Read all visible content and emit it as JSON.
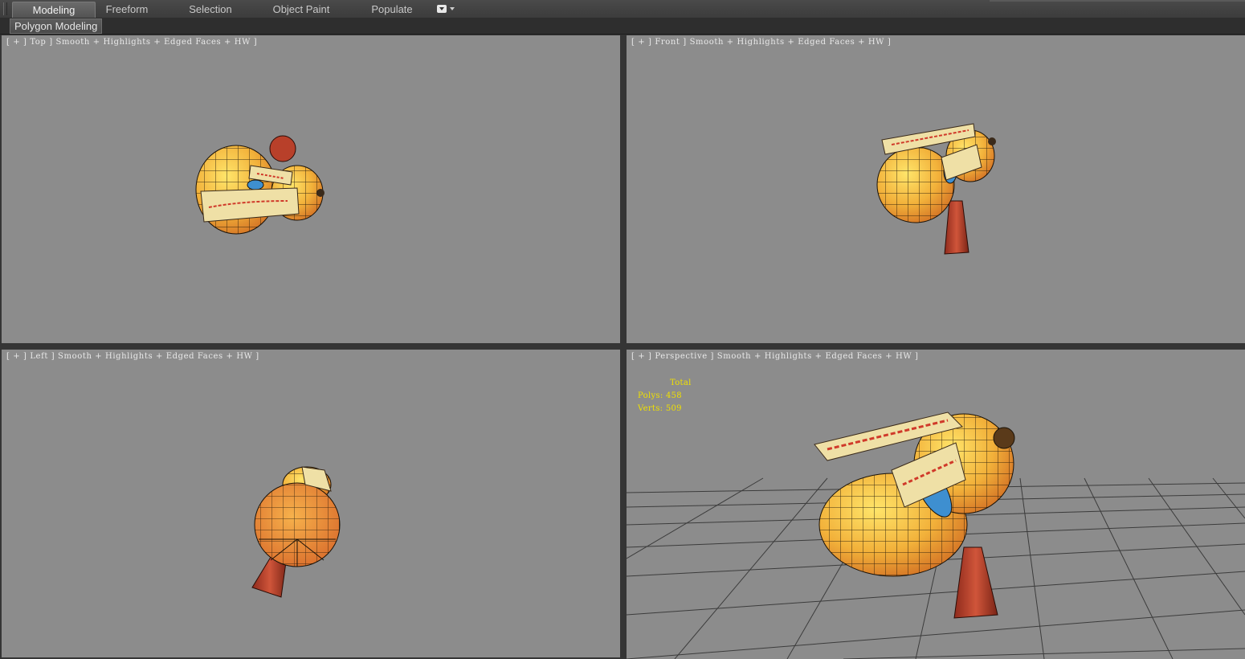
{
  "ribbon": {
    "tabs": [
      "Modeling",
      "Freeform",
      "Selection",
      "Object Paint",
      "Populate"
    ],
    "active_tab": "Modeling",
    "panel_label": "Polygon Modeling"
  },
  "viewports": {
    "top": {
      "label": "[ + ] Top ] Smooth + Highlights + Edged Faces + HW ]"
    },
    "front": {
      "label": "[ + ] Front ] Smooth + Highlights + Edged Faces + HW ]"
    },
    "left": {
      "label": "[ + ] Left ] Smooth + Highlights + Edged Faces + HW ]"
    },
    "perspective": {
      "label": "[ + ] Perspective ] Smooth + Highlights + Edged Faces + HW ]",
      "stats": {
        "header": "Total",
        "polys_label": "Polys:",
        "polys_value": "458",
        "verts_label": "Verts:",
        "verts_value": "509"
      }
    }
  },
  "colors": {
    "viewport_bg": "#8c8c8c",
    "gourd": "#f2b13a",
    "gourd_dark": "#d9782a",
    "tassel": "#b8402a",
    "paper": "#efe0a6",
    "ring": "#3e8fd0",
    "stats_text": "#f0e000"
  }
}
